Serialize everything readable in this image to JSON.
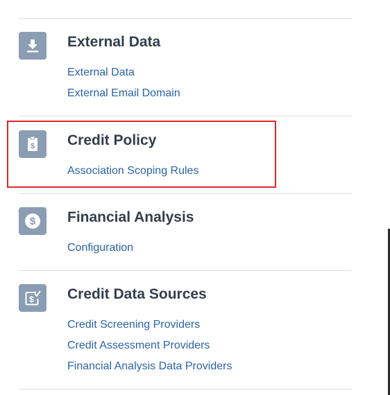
{
  "sections": [
    {
      "title": "External Data",
      "icon": "download-icon",
      "links": [
        "External Data",
        "External Email Domain"
      ]
    },
    {
      "title": "Credit Policy",
      "icon": "clipboard-dollar-icon",
      "links": [
        "Association Scoping Rules"
      ]
    },
    {
      "title": "Financial Analysis",
      "icon": "dollar-circle-icon",
      "links": [
        "Configuration"
      ]
    },
    {
      "title": "Credit Data Sources",
      "icon": "dollar-check-icon",
      "links": [
        "Credit Screening Providers",
        "Credit Assessment Providers",
        "Financial Analysis Data Providers"
      ]
    }
  ],
  "colors": {
    "icon_bg": "#8b9db3",
    "title": "#333e4d",
    "link": "#2b63a8",
    "highlight": "#e0262b"
  }
}
